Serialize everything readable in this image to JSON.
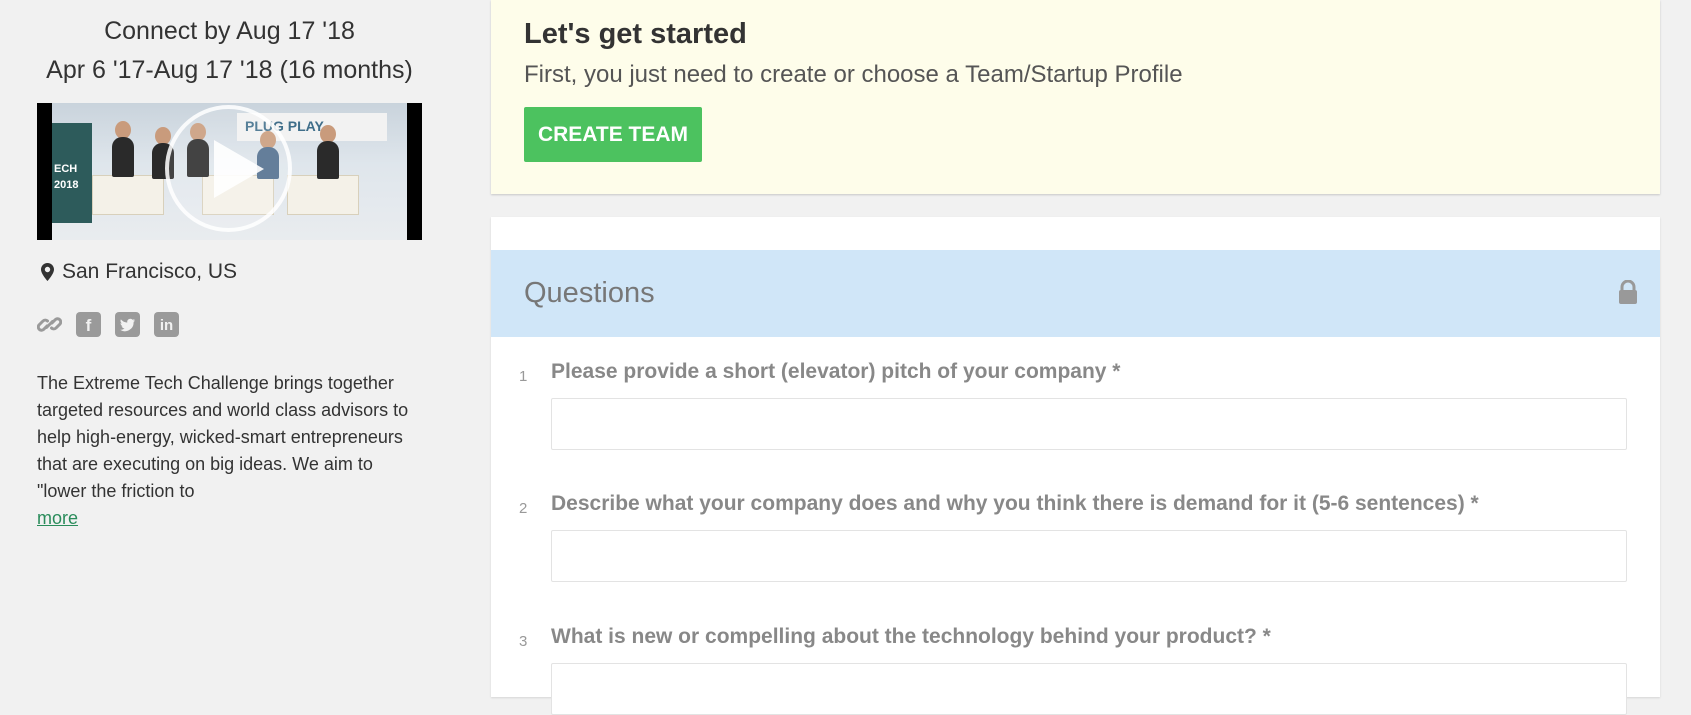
{
  "sidebar": {
    "deadline": "Connect by Aug 17 '18",
    "date_range": "Apr 6 '17-Aug 17 '18 (16 months)",
    "video_icon": "play-icon",
    "location": "San Francisco, US",
    "location_icon": "map-pin-icon",
    "social_icons": [
      "link-icon",
      "facebook-icon",
      "twitter-icon",
      "linkedin-icon"
    ],
    "description": "The Extreme Tech Challenge brings together targeted resources and world class advisors to help high-energy, wicked-smart entrepreneurs that are executing on big ideas. We aim to \"lower the friction to",
    "more_link": "more",
    "video_text": {
      "banner": "PLUG PLAY",
      "sign": "ECH 2018"
    }
  },
  "get_started": {
    "title": "Let's get started",
    "subtitle": "First, you just need to create or choose a Team/Startup Profile",
    "button": "CREATE TEAM"
  },
  "questions": {
    "header": "Questions",
    "header_icon": "lock-icon",
    "items": [
      {
        "number": "1",
        "label": "Please provide a short (elevator) pitch of your company *",
        "value": ""
      },
      {
        "number": "2",
        "label": "Describe what your company does and why you think there is demand for it (5-6 sentences) *",
        "value": ""
      },
      {
        "number": "3",
        "label": "What is new or compelling about the technology behind your product? *",
        "value": ""
      }
    ]
  },
  "colors": {
    "accent_green": "#4cc25f",
    "banner_yellow": "#fefdea",
    "questions_blue": "#d0e6f8",
    "link_green": "#2a8c5b"
  }
}
